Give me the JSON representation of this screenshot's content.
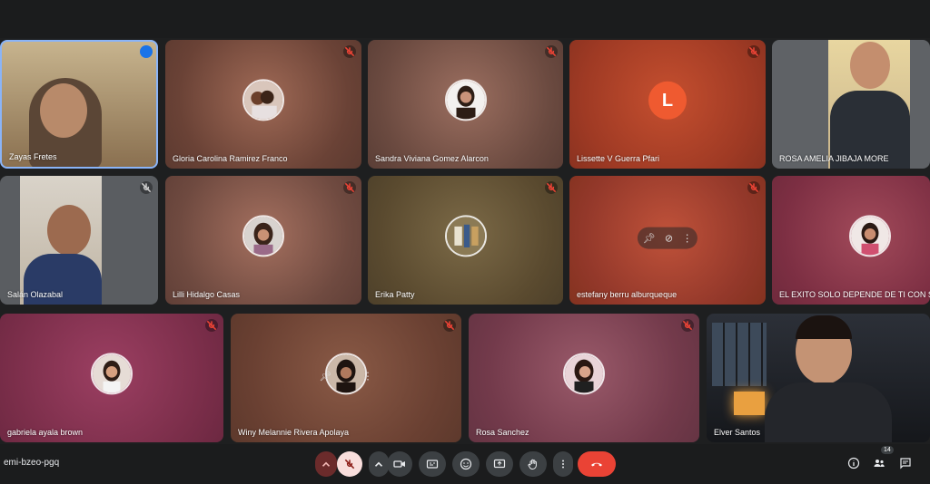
{
  "participants": [
    {
      "name": "Zayas Fretes"
    },
    {
      "name": "Gloria Carolina Ramirez Franco"
    },
    {
      "name": "Sandra Viviana Gomez Alarcon"
    },
    {
      "name": "Lissette V Guerra Pfari",
      "initial": "L"
    },
    {
      "name": "ROSA AMELIA JIBAJA MORE"
    },
    {
      "name": "Salán Olazabal"
    },
    {
      "name": "Lilli Hidalgo Casas"
    },
    {
      "name": "Erika Patty"
    },
    {
      "name": "estefany berru alburqueque"
    },
    {
      "name": "EL EXITO SOLO DEPENDE DE TI CON SO"
    },
    {
      "name": "gabriela ayala brown"
    },
    {
      "name": "Winy Melannie Rivera Apolaya"
    },
    {
      "name": "Rosa Sanchez"
    },
    {
      "name": "Elver Santos"
    }
  ],
  "meeting": {
    "code": "emi-bzeo-pgq",
    "participant_count": "14"
  },
  "colors": {
    "accent_red": "#ea4335",
    "control_bg": "#3c4043",
    "active_speaker_border": "#8ab4f8"
  }
}
